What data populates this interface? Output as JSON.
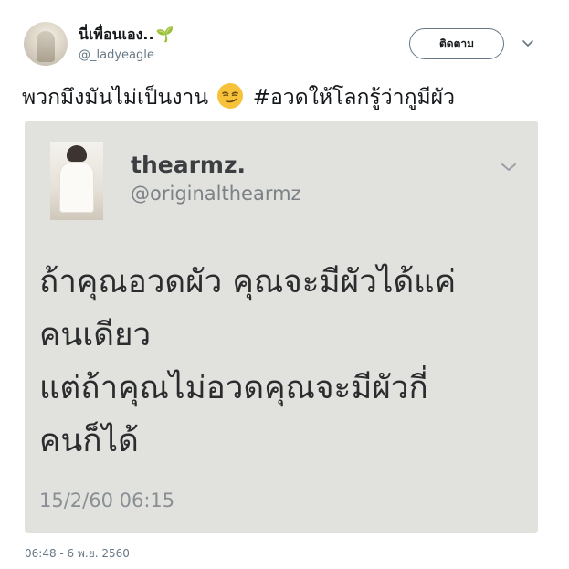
{
  "author": {
    "display_name": "นี่เพื่อนเอง..",
    "handle": "@_ladyeagle",
    "follow_label": "ติดตาม"
  },
  "tweet": {
    "text": "พวกมึงมันไม่เป็นงาน",
    "emoji": "smirking-face",
    "hashtag": "#อวดให้โลกรู้ว่ากูมีผัว",
    "timestamp": "06:48 - 6 พ.ย. 2560"
  },
  "quoted_tweet": {
    "display_name": "thearmz.",
    "handle": "@originalthearmz",
    "lines": [
      "ถ้าคุณอวดผัว คุณจะมีผัวได้แค่",
      "คนเดียว",
      "แต่ถ้าคุณไม่อวดคุณจะมีผัวกี่",
      "คนก็ได้"
    ],
    "time": "15/2/60 06:15"
  },
  "colors": {
    "text": "#14171a",
    "secondary": "#657786",
    "media_bg": "#e1e2de"
  }
}
